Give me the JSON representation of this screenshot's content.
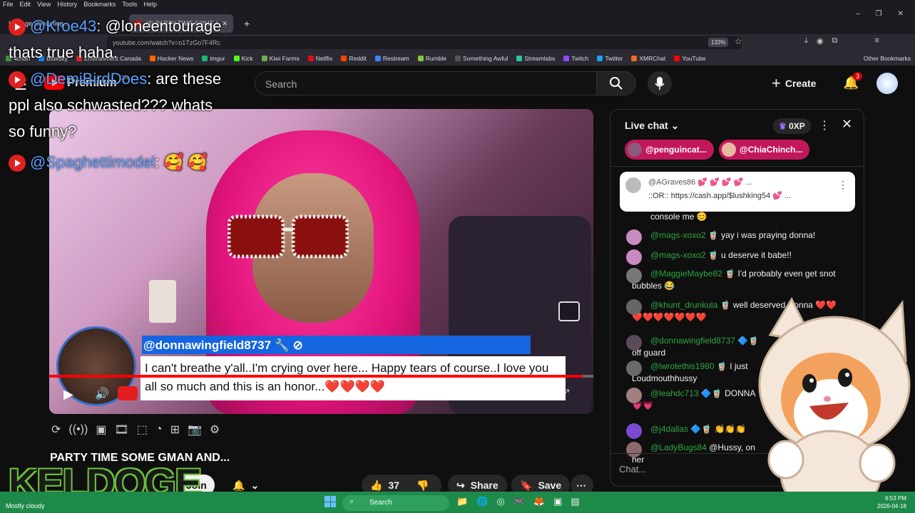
{
  "browser": {
    "menu": [
      "File",
      "Edit",
      "View",
      "History",
      "Bookmarks",
      "Tools",
      "Help"
    ],
    "tabs": [
      {
        "label": "Keldoge Streaming..."
      },
      {
        "label": "(3) PARTY TIME SOME GMA..."
      }
    ],
    "new_tab": "+",
    "url": "youtube.com/watch?v=o1TzGo7F4Rc",
    "zoom": "133%",
    "bookmarks": [
      {
        "label": "4chan",
        "color": "#3a9a3a"
      },
      {
        "label": "Bluesky",
        "color": "#1185fe"
      },
      {
        "label": "Environment Canada",
        "color": "#d22"
      },
      {
        "label": "Hacker News",
        "color": "#ff6600"
      },
      {
        "label": "imgur",
        "color": "#1bb76e"
      },
      {
        "label": "Kick",
        "color": "#53fc18"
      },
      {
        "label": "Kiwi Farms",
        "color": "#6ab04c"
      },
      {
        "label": "Netflix",
        "color": "#e50914"
      },
      {
        "label": "Reddit",
        "color": "#ff4500"
      },
      {
        "label": "Restream",
        "color": "#3b82f6"
      },
      {
        "label": "Rumble",
        "color": "#85c742"
      },
      {
        "label": "Something Awful",
        "color": "#555"
      },
      {
        "label": "Streamlabs",
        "color": "#31c3a2"
      },
      {
        "label": "Twitch",
        "color": "#9146ff"
      },
      {
        "label": "Twitter",
        "color": "#1da1f2"
      },
      {
        "label": "XMRChat",
        "color": "#f26822"
      },
      {
        "label": "YouTube",
        "color": "#f00"
      }
    ],
    "other_bookmarks": "Other Bookmarks"
  },
  "youtube": {
    "logo": "Premium",
    "region": "CA",
    "search_placeholder": "Search",
    "create_label": "Create",
    "notification_count": "3"
  },
  "overlay_chat": {
    "lines": [
      {
        "user": "@Kroe43",
        "text": "@loneentourage thats true haha."
      },
      {
        "user": "@DemiBirdDoes",
        "text": "are these ppl also schwasted??? whats so funny?"
      },
      {
        "user": "@Spaghettimodel",
        "text": "🥰 🥰"
      }
    ],
    "brand": "KELDOGE"
  },
  "video": {
    "superchat_user": "@donnawingfield8737 🔧 ⊘",
    "superchat_text": "I can't breathe y'all..I'm crying over here... Happy tears of course..I love you all so much and this is an honor...❤️❤️❤️❤️",
    "progress": 0.98,
    "title": "PARTY TIME SOME GMAN AND...",
    "join_label": "Join",
    "likes": "37",
    "share_label": "Share",
    "save_label": "Save"
  },
  "live_chat": {
    "header": "Live chat",
    "xp": "0XP",
    "tickers": [
      {
        "label": "@penguincat..."
      },
      {
        "label": "@ChiaChinch..."
      }
    ],
    "pinned": {
      "user": "@AGraves86",
      "text": "::OR:: https://cash.app/$lushking54 💕 ...",
      "prefix_text": "💕 💕 💕 💕 ..."
    },
    "messages": [
      {
        "user": "",
        "text": "console me 😊",
        "color": "#555"
      },
      {
        "user": "@mags-xoxo2 🧋",
        "text": "yay i was praying donna!",
        "color": "#c88ac0"
      },
      {
        "user": "@mags-xoxo2 🧋",
        "text": "u deserve it babe!!",
        "color": "#c88ac0"
      },
      {
        "user": "@MaggieMaybe82 🧋",
        "text": "I'd probably even get snot bubbles 😂",
        "color": "#777"
      },
      {
        "user": "@khunt_drunkula 🧋",
        "text": "well deserved Donna ❤️❤️❤️❤️❤️❤️❤️❤️❤️",
        "color": "#666"
      },
      {
        "user": "@donnawingfield8737 🔷🧋",
        "text": "off guard",
        "color": "#5a4a5a"
      },
      {
        "user": "@lwrotethis1980 🧋",
        "text": "I just Loudmouthhussy",
        "color": "#6a6a6a"
      },
      {
        "user": "@leahdc713 🔷🧋",
        "text": "DONNA 💗💗",
        "color": "#a08080"
      },
      {
        "user": "@j4dallas 🔷🧋",
        "text": "👏👏👏",
        "color": "#7a4ad0"
      },
      {
        "user": "@LadyBugs84",
        "text": "@Hussy, on her",
        "color": "#8a6a6a"
      }
    ],
    "input_placeholder": "Chat..."
  },
  "taskbar": {
    "weather": "Mostly cloudy",
    "search": "Search",
    "time": "6:53 PM",
    "date": "2026-04-18"
  }
}
